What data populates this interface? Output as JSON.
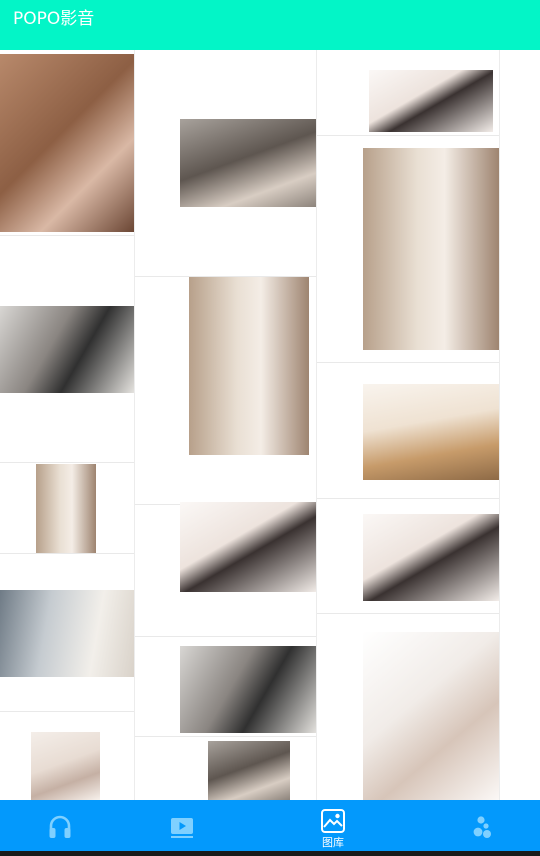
{
  "app": {
    "title": "POPO影音"
  },
  "colors": {
    "app_bar": "#03f5c7",
    "nav_bar": "#0399fc",
    "icon_inactive": "#7fd0ff",
    "icon_active": "#ffffff"
  },
  "gallery": {
    "columns": [
      {
        "name": "column-1",
        "thumbnails": 6
      },
      {
        "name": "column-2",
        "thumbnails": 6
      },
      {
        "name": "column-3",
        "thumbnails": 5
      }
    ]
  },
  "bottom_nav": {
    "items": [
      {
        "name": "music",
        "icon": "headphones-icon",
        "label": "",
        "active": false
      },
      {
        "name": "video",
        "icon": "play-video-icon",
        "label": "",
        "active": false
      },
      {
        "name": "gallery",
        "icon": "picture-icon",
        "label": "图库",
        "active": true
      },
      {
        "name": "more",
        "icon": "dots-icon",
        "label": "",
        "active": false
      }
    ]
  }
}
